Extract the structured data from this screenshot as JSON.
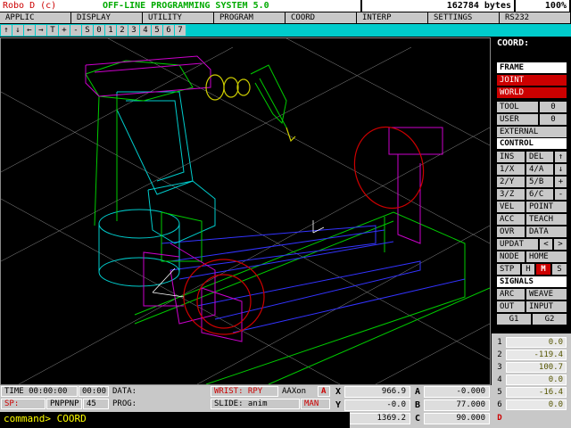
{
  "title": {
    "app_name": "Robo  D (c)",
    "system": "OFF-LINE PROGRAMMING SYSTEM 5.0",
    "bytes": "162784 bytes",
    "zoom": "100%"
  },
  "menu": [
    "APPLIC",
    "DISPLAY",
    "UTILITY",
    "PROGRAM",
    "COORD",
    "INTERP",
    "SETTINGS",
    "RS232"
  ],
  "toolbar": [
    "↑",
    "↓",
    "←",
    "→",
    "T",
    "+",
    "-",
    "S",
    "0",
    "1",
    "2",
    "3",
    "4",
    "5",
    "6",
    "7"
  ],
  "panel": {
    "header": "COORD:",
    "frame": "FRAME",
    "joint": "JOINT",
    "world": "WORLD",
    "tool": "TOOL",
    "tool_val": "0",
    "user": "USER",
    "user_val": "0",
    "external": "EXTERNAL",
    "control": "CONTROL",
    "ins": "INS",
    "del": "DEL",
    "one_x": "1/X",
    "four_a": "4/A",
    "two_y": "2/Y",
    "five_b": "5/B",
    "three_z": "3/Z",
    "six_c": "6/C",
    "vel": "VEL",
    "point": "POINT",
    "acc": "ACC",
    "teach": "TEACH",
    "ovr": "OVR",
    "data": "DATA",
    "updat": "UPDAT",
    "node": "NODE",
    "home": "HOME",
    "stp": "STP",
    "h": "H",
    "m": "M",
    "s": "S",
    "signals": "SIGNALS",
    "arc": "ARC",
    "weave": "WEAVE",
    "out": "OUT",
    "input": "INPUT",
    "g1": "G1",
    "g2": "G2"
  },
  "joints": [
    {
      "n": "1",
      "v": "0.0"
    },
    {
      "n": "2",
      "v": "-119.4"
    },
    {
      "n": "3",
      "v": "100.7"
    },
    {
      "n": "4",
      "v": "0.0"
    },
    {
      "n": "5",
      "v": "-16.4"
    },
    {
      "n": "6",
      "v": "0.0"
    },
    {
      "n": "D",
      "v": ""
    }
  ],
  "status": {
    "time_label": "TIME 00:00:00",
    "time2": "00:00",
    "data_label": "DATA:",
    "wrist": "WRIST: RPY",
    "aaxon": "AAXon",
    "a_flag": "A",
    "sp_label": "SP:",
    "pnppnp": "PNPPNP",
    "num": "45",
    "prog_label": "PROG:",
    "slide": "SLIDE: anim",
    "man": "MAN",
    "x_label": "X",
    "x_val": "966.9",
    "y_label": "Y",
    "y_val": "-0.0",
    "z_label": "Z",
    "z_val": "1369.2",
    "a_label": "A",
    "a_val": "-0.000",
    "b_label": "B",
    "b_val": "77.000",
    "c_label": "C",
    "c_val": "90.000",
    "command": "command> COORD"
  }
}
